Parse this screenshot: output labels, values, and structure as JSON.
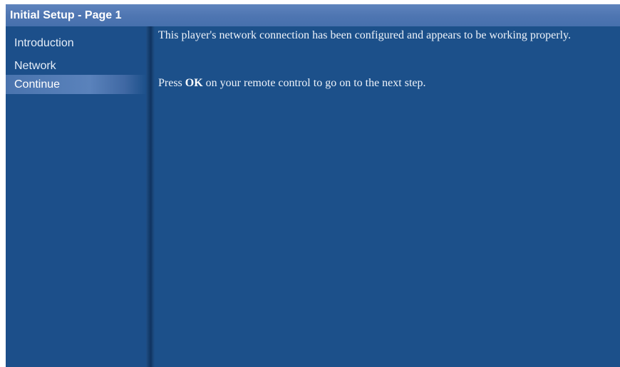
{
  "window": {
    "title": "Initial Setup - Page 1"
  },
  "sidebar": {
    "items": [
      {
        "label": "Introduction",
        "selected": false
      },
      {
        "label": "Network",
        "selected": false
      },
      {
        "label": "Continue",
        "selected": true
      }
    ]
  },
  "main": {
    "message": "This player's network connection has been configured and appears to be working properly.",
    "instruction": {
      "prefix": "Press ",
      "key": "OK",
      "suffix": " on your remote control to go on to the next step."
    }
  },
  "colors": {
    "background": "#1c508a",
    "titlebar": "#4f76b2",
    "selected_item": "#5a82bb",
    "text": "#ffffff"
  }
}
